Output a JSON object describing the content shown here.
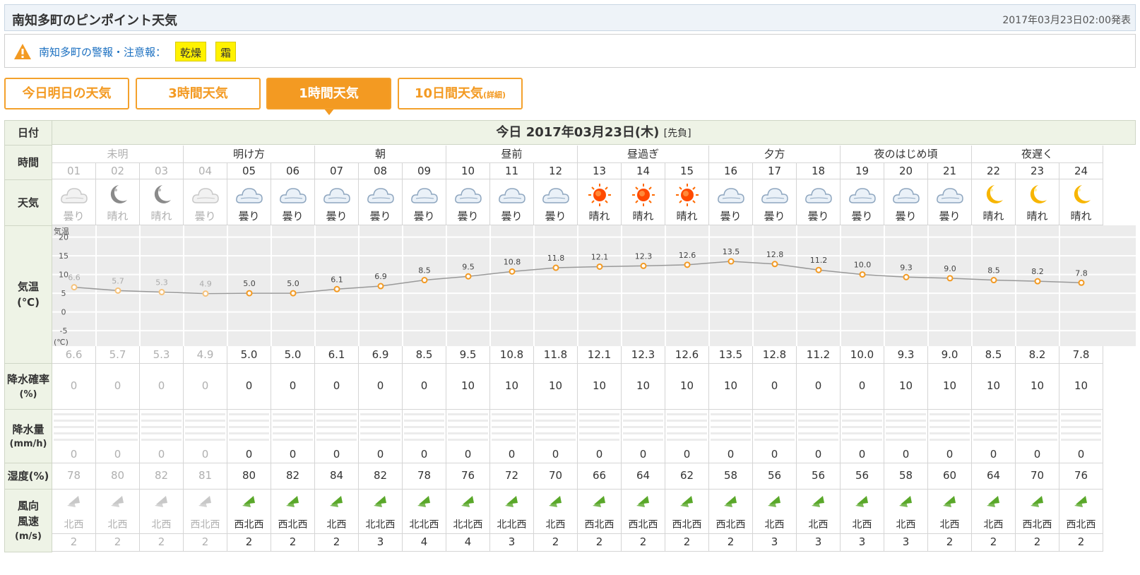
{
  "header": {
    "title": "南知多町のピンポイント天気",
    "issued": "2017年03月23日02:00発表"
  },
  "warning": {
    "label": "南知多町の警報・注意報：",
    "badges": [
      "乾燥",
      "霜"
    ]
  },
  "tabs": [
    {
      "label": "今日明日の天気",
      "active": false
    },
    {
      "label": "3時間天気",
      "active": false
    },
    {
      "label": "1時間天気",
      "active": true
    },
    {
      "label": "10日間天気",
      "sub": "(詳細)",
      "active": false
    }
  ],
  "table": {
    "labels": {
      "date": "日付",
      "time": "時間",
      "weather": "天気",
      "temp": "気温",
      "temp_unit": "(℃)",
      "precip_prob": "降水確率",
      "precip_prob_unit": "(%)",
      "precip": "降水量",
      "precip_unit": "(mm/h)",
      "humidity": "湿度(%)",
      "wind1": "風向",
      "wind2": "風速",
      "wind_unit": "(m/s)"
    },
    "date_header": {
      "today": "今日",
      "date": "2017年03月23日(木)",
      "rokuyo": "[先負]"
    },
    "periods": [
      "未明",
      "明け方",
      "朝",
      "昼前",
      "昼過ぎ",
      "夕方",
      "夜のはじめ頃",
      "夜遅く"
    ],
    "hours": [
      "01",
      "02",
      "03",
      "04",
      "05",
      "06",
      "07",
      "08",
      "09",
      "10",
      "11",
      "12",
      "13",
      "14",
      "15",
      "16",
      "17",
      "18",
      "19",
      "20",
      "21",
      "22",
      "23",
      "24"
    ],
    "weather": [
      "曇り",
      "晴れ",
      "晴れ",
      "曇り",
      "曇り",
      "曇り",
      "曇り",
      "曇り",
      "曇り",
      "曇り",
      "曇り",
      "曇り",
      "晴れ",
      "晴れ",
      "晴れ",
      "曇り",
      "曇り",
      "曇り",
      "曇り",
      "曇り",
      "曇り",
      "晴れ",
      "晴れ",
      "晴れ"
    ],
    "weather_icons": [
      "cloud-icon",
      "moon-icon",
      "moon-icon",
      "cloud-icon",
      "cloud-icon",
      "cloud-icon",
      "cloud-icon",
      "cloud-icon",
      "cloud-icon",
      "cloud-icon",
      "cloud-icon",
      "cloud-icon",
      "sun-icon",
      "sun-icon",
      "sun-icon",
      "cloud-icon",
      "cloud-icon",
      "cloud-icon",
      "cloud-icon",
      "cloud-icon",
      "cloud-icon",
      "moon-icon",
      "moon-icon",
      "moon-icon"
    ],
    "temps": [
      "6.6",
      "5.7",
      "5.3",
      "4.9",
      "5.0",
      "5.0",
      "6.1",
      "6.9",
      "8.5",
      "9.5",
      "10.8",
      "11.8",
      "12.1",
      "12.3",
      "12.6",
      "13.5",
      "12.8",
      "11.2",
      "10.0",
      "9.3",
      "9.0",
      "8.5",
      "8.2",
      "7.8"
    ],
    "precip_prob": [
      "0",
      "0",
      "0",
      "0",
      "0",
      "0",
      "0",
      "0",
      "0",
      "10",
      "10",
      "10",
      "10",
      "10",
      "10",
      "10",
      "0",
      "0",
      "0",
      "10",
      "10",
      "10",
      "10",
      "10"
    ],
    "precip": [
      "0",
      "0",
      "0",
      "0",
      "0",
      "0",
      "0",
      "0",
      "0",
      "0",
      "0",
      "0",
      "0",
      "0",
      "0",
      "0",
      "0",
      "0",
      "0",
      "0",
      "0",
      "0",
      "0",
      "0"
    ],
    "humidity": [
      "78",
      "80",
      "82",
      "81",
      "80",
      "82",
      "84",
      "82",
      "78",
      "76",
      "72",
      "70",
      "66",
      "64",
      "62",
      "58",
      "56",
      "56",
      "56",
      "58",
      "60",
      "64",
      "70",
      "76"
    ],
    "wind_dir": [
      "北西",
      "北西",
      "北西",
      "西北西",
      "西北西",
      "西北西",
      "北西",
      "北北西",
      "北北西",
      "北北西",
      "北北西",
      "北西",
      "西北西",
      "西北西",
      "西北西",
      "西北西",
      "北西",
      "北西",
      "北西",
      "北西",
      "北西",
      "北西",
      "西北西",
      "西北西"
    ],
    "wind_speed": [
      "2",
      "2",
      "2",
      "2",
      "2",
      "2",
      "2",
      "3",
      "4",
      "4",
      "3",
      "2",
      "2",
      "2",
      "2",
      "2",
      "3",
      "3",
      "3",
      "3",
      "2",
      "2",
      "2",
      "2"
    ],
    "past_hours": 4
  },
  "chart_data": {
    "type": "line",
    "x": [
      "01",
      "02",
      "03",
      "04",
      "05",
      "06",
      "07",
      "08",
      "09",
      "10",
      "11",
      "12",
      "13",
      "14",
      "15",
      "16",
      "17",
      "18",
      "19",
      "20",
      "21",
      "22",
      "23",
      "24"
    ],
    "series": [
      {
        "values": [
          6.6,
          5.7,
          5.3,
          4.9,
          5.0,
          5.0,
          6.1,
          6.9,
          8.5,
          9.5,
          10.8,
          11.8,
          12.1,
          12.3,
          12.6,
          13.5,
          12.8,
          11.2,
          10.0,
          9.3,
          9.0,
          8.5,
          8.2,
          7.8
        ]
      }
    ],
    "ylabel": "気温",
    "yunit": "(℃)",
    "yticks": [
      20,
      15,
      10,
      5,
      0,
      -5
    ],
    "ylim": [
      -8,
      22
    ],
    "grid": true,
    "colors": {
      "line": "#999999",
      "marker": "#f39a22",
      "marker_past": "#f6c27a"
    }
  },
  "colors": {
    "accent": "#f39a22",
    "label_bg": "#eef3e6",
    "header_bg": "#eef3f8",
    "badge": "#fff200",
    "wind_icon": "#5aa82a"
  }
}
